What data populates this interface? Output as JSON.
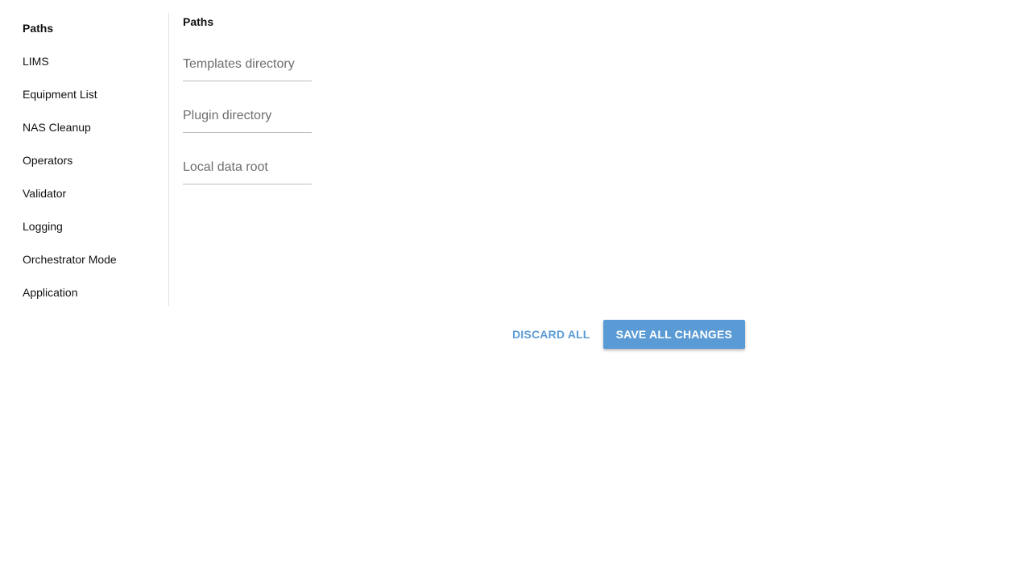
{
  "sidebar": {
    "items": [
      {
        "label": "Paths",
        "active": true
      },
      {
        "label": "LIMS",
        "active": false
      },
      {
        "label": "Equipment List",
        "active": false
      },
      {
        "label": "NAS Cleanup",
        "active": false
      },
      {
        "label": "Operators",
        "active": false
      },
      {
        "label": "Validator",
        "active": false
      },
      {
        "label": "Logging",
        "active": false
      },
      {
        "label": "Orchestrator Mode",
        "active": false
      },
      {
        "label": "Application",
        "active": false
      }
    ]
  },
  "main": {
    "title": "Paths",
    "fields": [
      {
        "placeholder": "Templates directory",
        "value": ""
      },
      {
        "placeholder": "Plugin directory",
        "value": ""
      },
      {
        "placeholder": "Local data root",
        "value": ""
      }
    ]
  },
  "actions": {
    "discard_label": "DISCARD ALL",
    "save_label": "SAVE ALL CHANGES"
  },
  "colors": {
    "accent": "#5b9bd5",
    "text": "#111111",
    "placeholder": "#6e6e6e",
    "divider": "#e2e2e2"
  }
}
